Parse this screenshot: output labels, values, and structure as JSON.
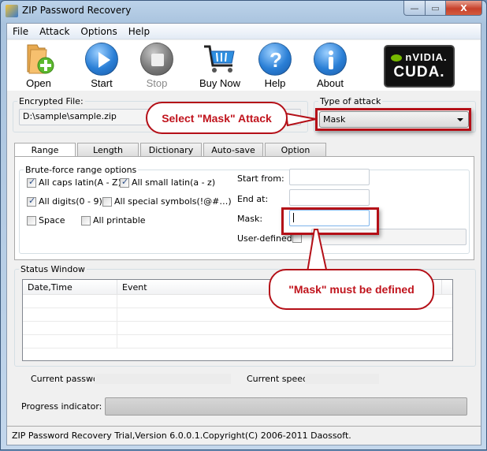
{
  "window": {
    "title": "ZIP Password Recovery",
    "controls": {
      "minimize": "—",
      "maximize": "▭",
      "close": "X"
    }
  },
  "menu": [
    "File",
    "Attack",
    "Options",
    "Help"
  ],
  "toolbar": {
    "open": "Open",
    "start": "Start",
    "stop": "Stop",
    "buy_now": "Buy Now",
    "help": "Help",
    "about": "About",
    "badge_line1": "nVIDIA.",
    "badge_line2": "CUDA."
  },
  "encrypted_file": {
    "legend": "Encrypted File:",
    "value": "D:\\sample\\sample.zip"
  },
  "attack_type": {
    "legend": "Type of attack",
    "selected": "Mask"
  },
  "tabs": [
    {
      "label": "Range",
      "active": true
    },
    {
      "label": "Length"
    },
    {
      "label": "Dictionary"
    },
    {
      "label": "Auto-save"
    },
    {
      "label": "Option"
    }
  ],
  "range": {
    "group_legend": "Brute-force range options",
    "options": [
      {
        "label": "All caps latin(A - Z)",
        "checked": true
      },
      {
        "label": "All small latin(a - z)",
        "checked": true
      },
      {
        "label": "All digits(0 - 9)",
        "checked": true
      },
      {
        "label": "All special symbols(!@#…)",
        "checked": false
      },
      {
        "label": "Space",
        "checked": false
      },
      {
        "label": "All printable",
        "checked": false
      }
    ],
    "start_from_label": "Start from:",
    "start_from_value": "",
    "end_at_label": "End at:",
    "end_at_value": "",
    "mask_label": "Mask:",
    "mask_value": "",
    "user_defined_label": "User-defined",
    "user_defined_checked": false,
    "user_defined_value": ""
  },
  "status_window": {
    "legend": "Status Window",
    "columns": [
      "Date,Time",
      "Event"
    ],
    "rows": []
  },
  "current_password_label": "Current password:",
  "current_password_value": "",
  "current_speed_label": "Current speed:",
  "current_speed_value": "",
  "progress_label": "Progress indicator:",
  "progress_percent": 0,
  "statusbar_text": "ZIP Password Recovery Trial,Version 6.0.0.1.Copyright(C) 2006-2011 Daossoft.",
  "annotations": {
    "callout_attack": "Select \"Mask\" Attack",
    "callout_mask": "\"Mask\" must be defined",
    "color": "#b40f17"
  }
}
